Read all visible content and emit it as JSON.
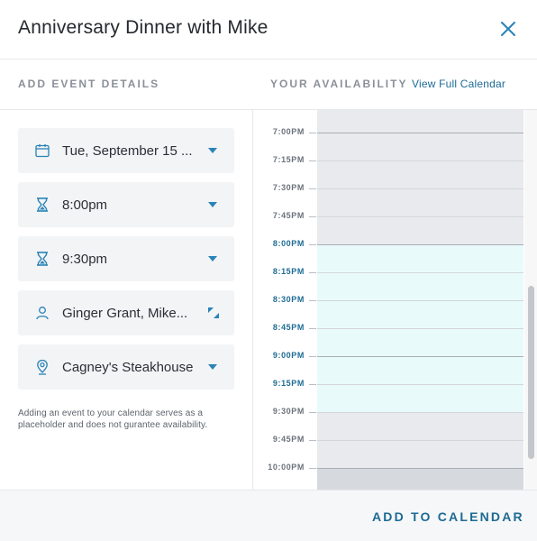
{
  "header": {
    "title": "Anniversary Dinner with Mike",
    "close_icon": "close-icon"
  },
  "sections": {
    "left_label": "ADD EVENT DETAILS",
    "right_label": "YOUR AVAILABILITY",
    "view_link": "View Full Calendar"
  },
  "fields": [
    {
      "icon": "calendar-icon",
      "value": "Tue, September 15 ...",
      "control": "dropdown"
    },
    {
      "icon": "hourglass-icon",
      "value": "8:00pm",
      "control": "dropdown"
    },
    {
      "icon": "hourglass-icon",
      "value": "9:30pm",
      "control": "dropdown"
    },
    {
      "icon": "person-icon",
      "value": "Ginger Grant, Mike...",
      "control": "expand"
    },
    {
      "icon": "location-pin-icon",
      "value": "Cagney's Steakhouse",
      "control": "dropdown"
    }
  ],
  "disclaimer": "Adding an event to your calendar serves as a placeholder and does not gurantee availability.",
  "calendar": {
    "times": [
      {
        "label": "7:00PM",
        "active": false
      },
      {
        "label": "7:15PM",
        "active": false
      },
      {
        "label": "7:30PM",
        "active": false
      },
      {
        "label": "7:45PM",
        "active": false
      },
      {
        "label": "8:00PM",
        "active": true
      },
      {
        "label": "8:15PM",
        "active": true
      },
      {
        "label": "8:30PM",
        "active": true
      },
      {
        "label": "8:45PM",
        "active": true
      },
      {
        "label": "9:00PM",
        "active": true
      },
      {
        "label": "9:15PM",
        "active": true
      },
      {
        "label": "9:30PM",
        "active": false
      },
      {
        "label": "9:45PM",
        "active": false
      },
      {
        "label": "10:00PM",
        "active": false
      }
    ],
    "selected_start": "8:00PM",
    "selected_end": "9:30PM"
  },
  "footer": {
    "add_button": "ADD TO CALENDAR"
  },
  "colors": {
    "accent": "#1d6b94",
    "icon": "#2a83b6",
    "highlight": "#e9fafb"
  }
}
